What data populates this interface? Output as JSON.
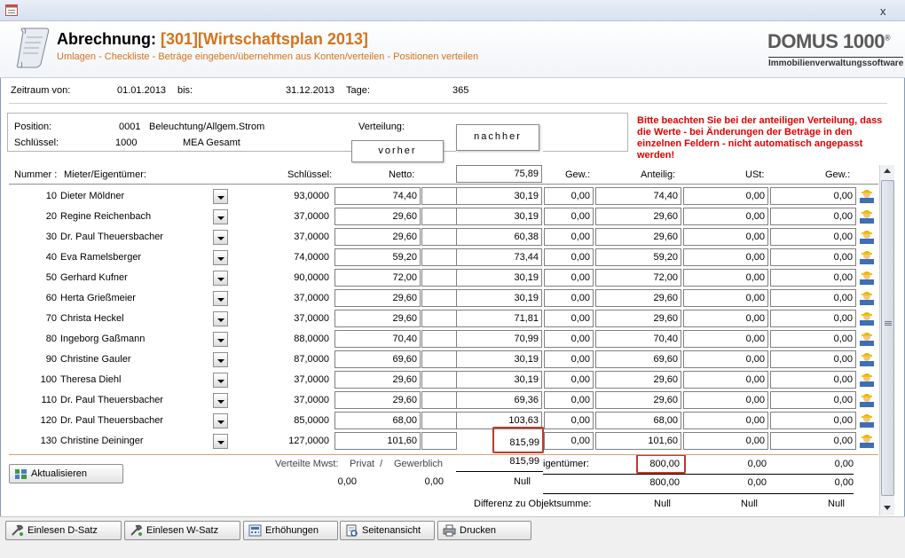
{
  "window": {
    "close_label": "x"
  },
  "header": {
    "title_prefix": "Abrechnung:",
    "title_code": "[301][Wirtschaftsplan 2013]",
    "subtitle": "Umlagen - Checkliste - Beträge eingeben/übernehmen aus Konten/verteilen - Positionen verteilen",
    "brand": "DOMUS 1000",
    "brand_reg": "®",
    "brand_sub": "Immobilienverwaltungssoftware"
  },
  "period": {
    "from_label": "Zeitraum von:",
    "from_value": "01.01.2013",
    "to_label": "bis:",
    "to_value": "31.12.2013",
    "days_label": "Tage:",
    "days_value": "365"
  },
  "info": {
    "position_label": "Position:",
    "position_no": "0001",
    "position_name": "Beleuchtung/Allgem.Strom",
    "key_label": "Schlüssel:",
    "key_no": "1000",
    "key_name": "MEA Gesamt",
    "distribution_label": "Verteilung:"
  },
  "warning": "Bitte beachten Sie bei der anteiligen Verteilung, dass die Werte - bei Änderungen der Beträge in den einzelnen Feldern - nicht automatisch angepasst werden!",
  "popups": {
    "before": "vorher",
    "after": "nachher"
  },
  "columns": {
    "number": "Nummer :",
    "tenant": "Mieter/Eigentümer:",
    "key": "Schlüssel:",
    "net": "Netto:",
    "weight1": "Gew.:",
    "share": "Anteilig:",
    "vat": "USt:",
    "weight2": "Gew.:"
  },
  "after_total": "75,89",
  "rows": [
    {
      "no": "10",
      "name": "Dieter Möldner",
      "key": "93,0000",
      "net": "74,40",
      "after": "30,19",
      "w1": "0,00",
      "share": "74,40",
      "vat": "0,00",
      "w2": "0,00"
    },
    {
      "no": "20",
      "name": "Regine Reichenbach",
      "key": "37,0000",
      "net": "29,60",
      "after": "30,19",
      "w1": "0,00",
      "share": "29,60",
      "vat": "0,00",
      "w2": "0,00"
    },
    {
      "no": "30",
      "name": "Dr. Paul Theuersbacher",
      "key": "37,0000",
      "net": "29,60",
      "after": "60,38",
      "w1": "0,00",
      "share": "29,60",
      "vat": "0,00",
      "w2": "0,00"
    },
    {
      "no": "40",
      "name": "Eva Ramelsberger",
      "key": "74,0000",
      "net": "59,20",
      "after": "73,44",
      "w1": "0,00",
      "share": "59,20",
      "vat": "0,00",
      "w2": "0,00"
    },
    {
      "no": "50",
      "name": "Gerhard Kufner",
      "key": "90,0000",
      "net": "72,00",
      "after": "30,19",
      "w1": "0,00",
      "share": "72,00",
      "vat": "0,00",
      "w2": "0,00"
    },
    {
      "no": "60",
      "name": "Herta Grießmeier",
      "key": "37,0000",
      "net": "29,60",
      "after": "30,19",
      "w1": "0,00",
      "share": "29,60",
      "vat": "0,00",
      "w2": "0,00"
    },
    {
      "no": "70",
      "name": "Christa Heckel",
      "key": "37,0000",
      "net": "29,60",
      "after": "71,81",
      "w1": "0,00",
      "share": "29,60",
      "vat": "0,00",
      "w2": "0,00"
    },
    {
      "no": "80",
      "name": "Ingeborg Gaßmann",
      "key": "88,0000",
      "net": "70,40",
      "after": "70,99",
      "w1": "0,00",
      "share": "70,40",
      "vat": "0,00",
      "w2": "0,00"
    },
    {
      "no": "90",
      "name": "Christine Gauler",
      "key": "87,0000",
      "net": "69,60",
      "after": "30,19",
      "w1": "0,00",
      "share": "69,60",
      "vat": "0,00",
      "w2": "0,00"
    },
    {
      "no": "100",
      "name": "Theresa Diehl",
      "key": "37,0000",
      "net": "29,60",
      "after": "30,19",
      "w1": "0,00",
      "share": "29,60",
      "vat": "0,00",
      "w2": "0,00"
    },
    {
      "no": "110",
      "name": "Dr. Paul Theuersbacher",
      "key": "37,0000",
      "net": "29,60",
      "after": "69,36",
      "w1": "0,00",
      "share": "29,60",
      "vat": "0,00",
      "w2": "0,00"
    },
    {
      "no": "120",
      "name": "Dr. Paul Theuersbacher",
      "key": "85,0000",
      "net": "68,00",
      "after": "103,63",
      "w1": "0,00",
      "share": "68,00",
      "vat": "0,00",
      "w2": "0,00"
    },
    {
      "no": "130",
      "name": "Christine Deininger",
      "key": "127,0000",
      "net": "101,60",
      "after": "815,99",
      "w1": "0,00",
      "share": "101,60",
      "vat": "0,00",
      "w2": "0,00"
    }
  ],
  "footer": {
    "refresh_button": "Aktualisieren",
    "vat_label": "Verteilte Mwst:",
    "private_label": "Privat",
    "slash": "/",
    "business_label": "Gewerblich",
    "private_value": "0,00",
    "business_value": "0,00",
    "after_sum": "815,99",
    "after_null": "Null",
    "owner_label": "igentümer:",
    "sum1_share": "800,00",
    "sum1_vat": "0,00",
    "sum1_w2": "0,00",
    "sum2_share": "800,00",
    "sum2_vat": "0,00",
    "sum2_w2": "0,00",
    "diff_label": "Differenz zu Objektsumme:",
    "diff_share": "Null",
    "diff_vat": "Null",
    "diff_w2": "Null"
  },
  "buttons": {
    "read_d": "Einlesen D-Satz",
    "read_w": "Einlesen W-Satz",
    "increase": "Erhöhungen",
    "page_view": "Seitenansicht",
    "print": "Drucken"
  }
}
